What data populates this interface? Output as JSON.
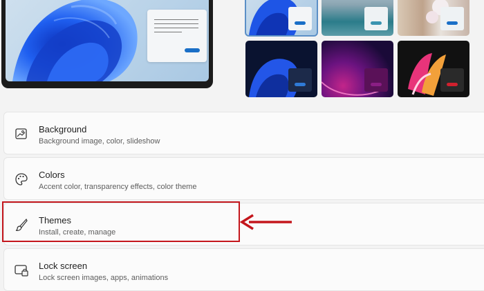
{
  "settings": {
    "items": [
      {
        "title": "Background",
        "subtitle": "Background image, color, slideshow",
        "icon": "image-icon"
      },
      {
        "title": "Colors",
        "subtitle": "Accent color, transparency effects, color theme",
        "icon": "palette-icon"
      },
      {
        "title": "Themes",
        "subtitle": "Install, create, manage",
        "icon": "brush-icon"
      },
      {
        "title": "Lock screen",
        "subtitle": "Lock screen images, apps, animations",
        "icon": "lock-screen-icon"
      }
    ]
  },
  "themes": {
    "thumbnails": [
      {
        "name": "windows-light-bloom",
        "selected": true
      },
      {
        "name": "lake",
        "selected": false
      },
      {
        "name": "flowers",
        "selected": false
      },
      {
        "name": "windows-dark-bloom",
        "selected": false
      },
      {
        "name": "glow",
        "selected": false
      },
      {
        "name": "captured-motion",
        "selected": false
      }
    ]
  },
  "annotation": {
    "highlighted_item": "Themes",
    "color": "#c4161c"
  }
}
